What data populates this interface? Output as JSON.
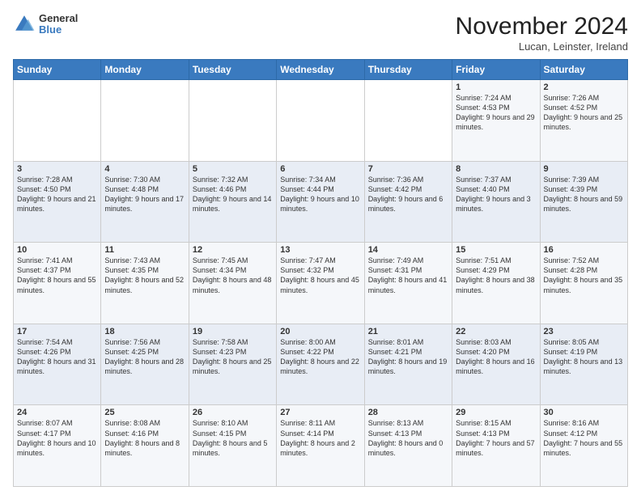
{
  "header": {
    "logo_general": "General",
    "logo_blue": "Blue",
    "month_title": "November 2024",
    "subtitle": "Lucan, Leinster, Ireland"
  },
  "days_of_week": [
    "Sunday",
    "Monday",
    "Tuesday",
    "Wednesday",
    "Thursday",
    "Friday",
    "Saturday"
  ],
  "weeks": [
    [
      null,
      null,
      null,
      null,
      null,
      {
        "num": "1",
        "sunrise": "7:24 AM",
        "sunset": "4:53 PM",
        "daylight": "9 hours and 29 minutes."
      },
      {
        "num": "2",
        "sunrise": "7:26 AM",
        "sunset": "4:52 PM",
        "daylight": "9 hours and 25 minutes."
      }
    ],
    [
      {
        "num": "3",
        "sunrise": "7:28 AM",
        "sunset": "4:50 PM",
        "daylight": "9 hours and 21 minutes."
      },
      {
        "num": "4",
        "sunrise": "7:30 AM",
        "sunset": "4:48 PM",
        "daylight": "9 hours and 17 minutes."
      },
      {
        "num": "5",
        "sunrise": "7:32 AM",
        "sunset": "4:46 PM",
        "daylight": "9 hours and 14 minutes."
      },
      {
        "num": "6",
        "sunrise": "7:34 AM",
        "sunset": "4:44 PM",
        "daylight": "9 hours and 10 minutes."
      },
      {
        "num": "7",
        "sunrise": "7:36 AM",
        "sunset": "4:42 PM",
        "daylight": "9 hours and 6 minutes."
      },
      {
        "num": "8",
        "sunrise": "7:37 AM",
        "sunset": "4:40 PM",
        "daylight": "9 hours and 3 minutes."
      },
      {
        "num": "9",
        "sunrise": "7:39 AM",
        "sunset": "4:39 PM",
        "daylight": "8 hours and 59 minutes."
      }
    ],
    [
      {
        "num": "10",
        "sunrise": "7:41 AM",
        "sunset": "4:37 PM",
        "daylight": "8 hours and 55 minutes."
      },
      {
        "num": "11",
        "sunrise": "7:43 AM",
        "sunset": "4:35 PM",
        "daylight": "8 hours and 52 minutes."
      },
      {
        "num": "12",
        "sunrise": "7:45 AM",
        "sunset": "4:34 PM",
        "daylight": "8 hours and 48 minutes."
      },
      {
        "num": "13",
        "sunrise": "7:47 AM",
        "sunset": "4:32 PM",
        "daylight": "8 hours and 45 minutes."
      },
      {
        "num": "14",
        "sunrise": "7:49 AM",
        "sunset": "4:31 PM",
        "daylight": "8 hours and 41 minutes."
      },
      {
        "num": "15",
        "sunrise": "7:51 AM",
        "sunset": "4:29 PM",
        "daylight": "8 hours and 38 minutes."
      },
      {
        "num": "16",
        "sunrise": "7:52 AM",
        "sunset": "4:28 PM",
        "daylight": "8 hours and 35 minutes."
      }
    ],
    [
      {
        "num": "17",
        "sunrise": "7:54 AM",
        "sunset": "4:26 PM",
        "daylight": "8 hours and 31 minutes."
      },
      {
        "num": "18",
        "sunrise": "7:56 AM",
        "sunset": "4:25 PM",
        "daylight": "8 hours and 28 minutes."
      },
      {
        "num": "19",
        "sunrise": "7:58 AM",
        "sunset": "4:23 PM",
        "daylight": "8 hours and 25 minutes."
      },
      {
        "num": "20",
        "sunrise": "8:00 AM",
        "sunset": "4:22 PM",
        "daylight": "8 hours and 22 minutes."
      },
      {
        "num": "21",
        "sunrise": "8:01 AM",
        "sunset": "4:21 PM",
        "daylight": "8 hours and 19 minutes."
      },
      {
        "num": "22",
        "sunrise": "8:03 AM",
        "sunset": "4:20 PM",
        "daylight": "8 hours and 16 minutes."
      },
      {
        "num": "23",
        "sunrise": "8:05 AM",
        "sunset": "4:19 PM",
        "daylight": "8 hours and 13 minutes."
      }
    ],
    [
      {
        "num": "24",
        "sunrise": "8:07 AM",
        "sunset": "4:17 PM",
        "daylight": "8 hours and 10 minutes."
      },
      {
        "num": "25",
        "sunrise": "8:08 AM",
        "sunset": "4:16 PM",
        "daylight": "8 hours and 8 minutes."
      },
      {
        "num": "26",
        "sunrise": "8:10 AM",
        "sunset": "4:15 PM",
        "daylight": "8 hours and 5 minutes."
      },
      {
        "num": "27",
        "sunrise": "8:11 AM",
        "sunset": "4:14 PM",
        "daylight": "8 hours and 2 minutes."
      },
      {
        "num": "28",
        "sunrise": "8:13 AM",
        "sunset": "4:13 PM",
        "daylight": "8 hours and 0 minutes."
      },
      {
        "num": "29",
        "sunrise": "8:15 AM",
        "sunset": "4:13 PM",
        "daylight": "7 hours and 57 minutes."
      },
      {
        "num": "30",
        "sunrise": "8:16 AM",
        "sunset": "4:12 PM",
        "daylight": "7 hours and 55 minutes."
      }
    ]
  ],
  "labels": {
    "sunrise": "Sunrise:",
    "sunset": "Sunset:",
    "daylight": "Daylight:"
  }
}
